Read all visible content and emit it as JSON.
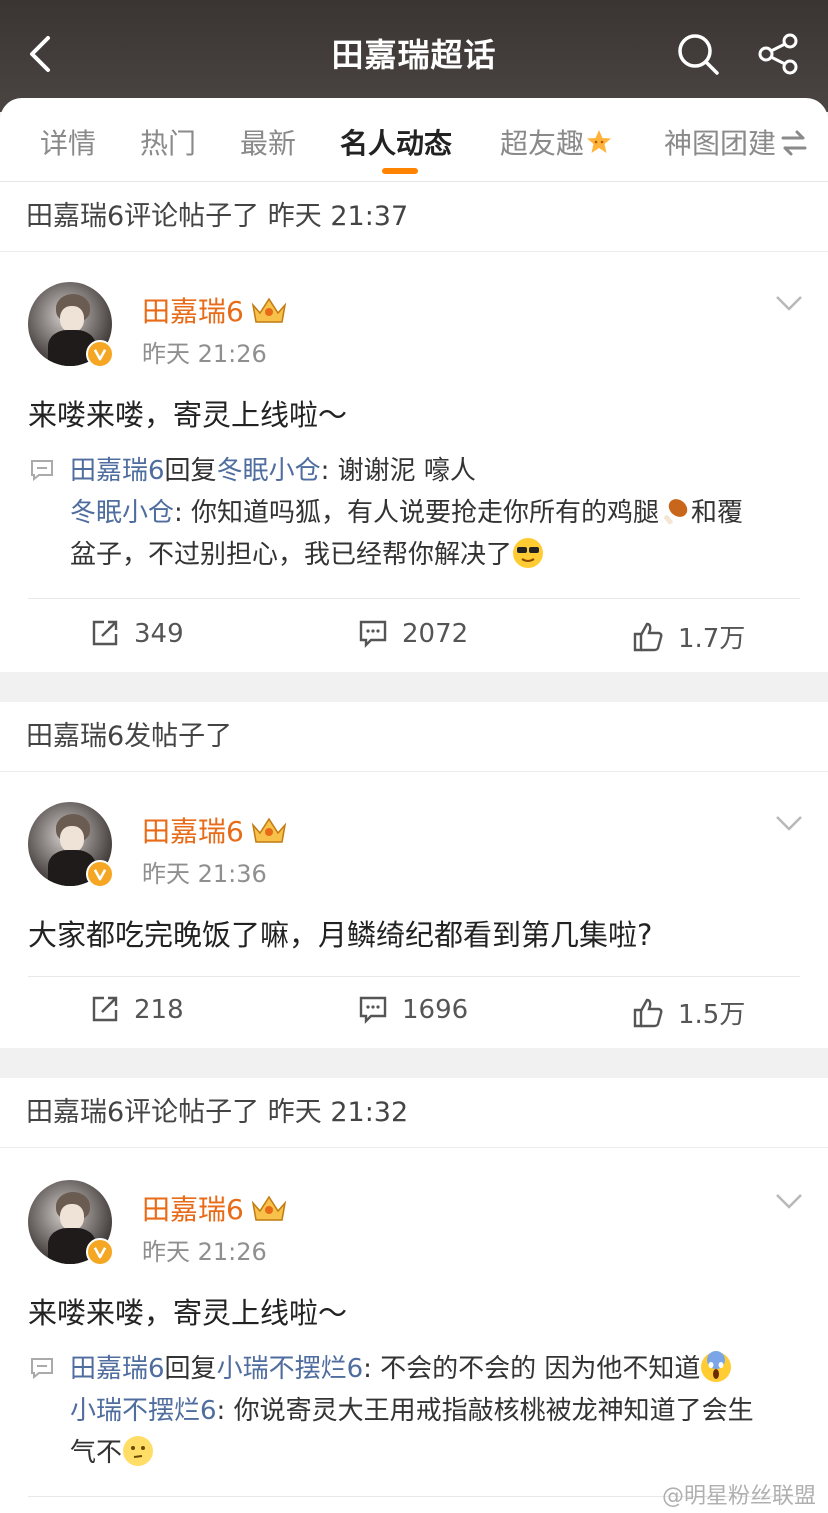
{
  "header": {
    "title": "田嘉瑞超话"
  },
  "tabs": [
    {
      "label": "详情"
    },
    {
      "label": "热门"
    },
    {
      "label": "最新"
    },
    {
      "label": "名人动态"
    },
    {
      "label": "超友趣"
    },
    {
      "label": "神图团建"
    }
  ],
  "sections": [
    {
      "head": "田嘉瑞6评论帖子了 昨天 21:37",
      "post": {
        "name": "田嘉瑞6",
        "time": "昨天 21:26",
        "content": "来喽来喽，寄灵上线啦～",
        "comments": [
          {
            "user1": "田嘉瑞6",
            "mid": "回复",
            "user2": "冬眠小仓",
            "text": ": 谢谢泥 嚎人"
          },
          {
            "user1": "冬眠小仓",
            "text1": ": 你知道吗狐，有人说要抢走你所有的鸡腿",
            "text2": "和覆",
            "text3": "盆子，不过别担心，我已经帮你解决了"
          }
        ],
        "repost": "349",
        "comment": "2072",
        "like": "1.7万"
      }
    },
    {
      "head": "田嘉瑞6发帖子了",
      "post": {
        "name": "田嘉瑞6",
        "time": "昨天 21:36",
        "content": "大家都吃完晚饭了嘛，月鳞绮纪都看到第几集啦?",
        "repost": "218",
        "comment": "1696",
        "like": "1.5万"
      }
    },
    {
      "head": "田嘉瑞6评论帖子了 昨天 21:32",
      "post": {
        "name": "田嘉瑞6",
        "time": "昨天 21:26",
        "content": "来喽来喽，寄灵上线啦～",
        "comments": [
          {
            "user1": "田嘉瑞6",
            "mid": "回复",
            "user2": "小瑞不摆烂6",
            "text": ": 不会的不会的 因为他不知道"
          },
          {
            "user1": "小瑞不摆烂6",
            "text1": ": 你说寄灵大王用戒指敲核桃被龙神知道了会生",
            "text3": "气不"
          }
        ]
      }
    }
  ],
  "watermark": "@明星粉丝联盟",
  "colors": {
    "accent": "#ff8200",
    "name": "#e86b18",
    "link": "#4f6d9e"
  }
}
